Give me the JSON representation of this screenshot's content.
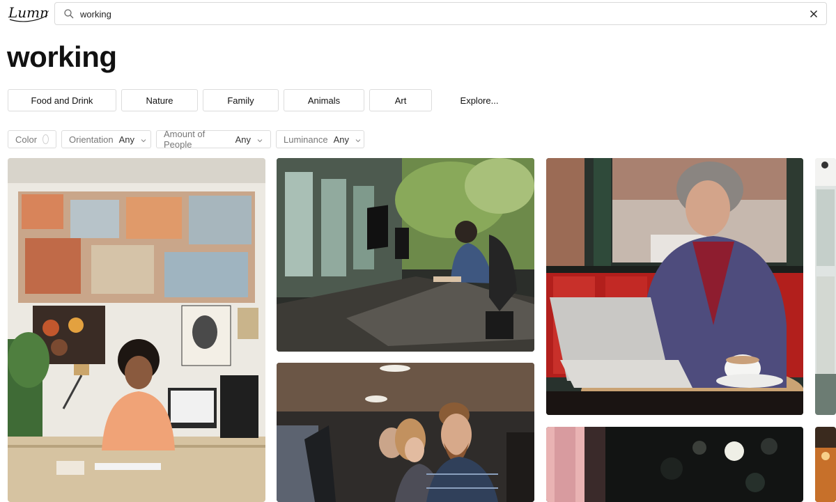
{
  "brand": {
    "logo_text": "Lummi"
  },
  "search": {
    "value": "working",
    "icon": "search-icon",
    "clear_icon": "close-icon"
  },
  "page": {
    "title": "working"
  },
  "categories": [
    {
      "label": "Food and Drink"
    },
    {
      "label": "Nature"
    },
    {
      "label": "Family"
    },
    {
      "label": "Animals"
    },
    {
      "label": "Art"
    }
  ],
  "explore_label": "Explore...",
  "filters": {
    "color": {
      "label": "Color"
    },
    "orientation": {
      "label": "Orientation",
      "value": "Any"
    },
    "people": {
      "label": "Amount of People",
      "value": "Any"
    },
    "luminance": {
      "label": "Luminance",
      "value": "Any"
    }
  },
  "photos": [
    {
      "subject": "woman-art-studio-desk"
    },
    {
      "subject": "man-office-computers"
    },
    {
      "subject": "man-laptop-cafe-coffee"
    },
    {
      "subject": "team-at-computers"
    },
    {
      "subject": "dark-bokeh-office"
    },
    {
      "subject": "partial-office-window"
    }
  ]
}
